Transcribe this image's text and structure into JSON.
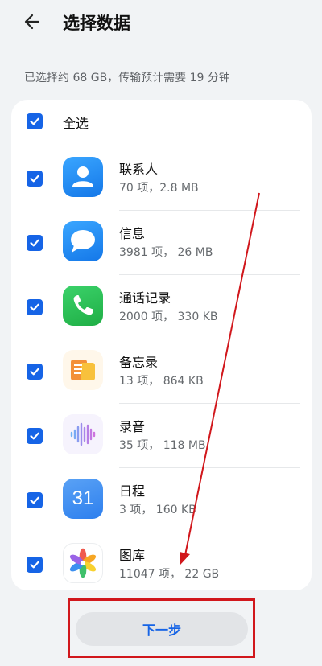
{
  "header": {
    "title": "选择数据",
    "back_icon": "arrow-left-icon"
  },
  "summary": "已选择约 68 GB，传输预计需要 19 分钟",
  "select_all": {
    "label": "全选",
    "checked": true
  },
  "items": [
    {
      "name": "联系人",
      "detail": "70 项，2.8 MB",
      "checked": true,
      "icon": "contacts-icon",
      "color": "#1e8cf0"
    },
    {
      "name": "信息",
      "detail": "3981 项， 26 MB",
      "checked": true,
      "icon": "messages-icon",
      "color": "#1e8cf0"
    },
    {
      "name": "通话记录",
      "detail": "2000 项， 330 KB",
      "checked": true,
      "icon": "phone-icon",
      "color": "#27c24c"
    },
    {
      "name": "备忘录",
      "detail": "13 项， 864 KB",
      "checked": true,
      "icon": "notes-icon",
      "color": "#f4a12a"
    },
    {
      "name": "录音",
      "detail": "35 项， 118 MB",
      "checked": true,
      "icon": "recorder-icon",
      "color": "#9b7de8"
    },
    {
      "name": "日程",
      "detail": "3 项， 160 KB",
      "checked": true,
      "icon": "calendar-icon",
      "day": "31",
      "color": "#3d8ef0"
    },
    {
      "name": "图库",
      "detail": "11047 项， 22 GB",
      "checked": true,
      "icon": "gallery-icon"
    }
  ],
  "next_button": {
    "label": "下一步"
  },
  "colors": {
    "accent": "#1664e6",
    "annotation": "#d1171c",
    "background": "#f1f3f5"
  }
}
